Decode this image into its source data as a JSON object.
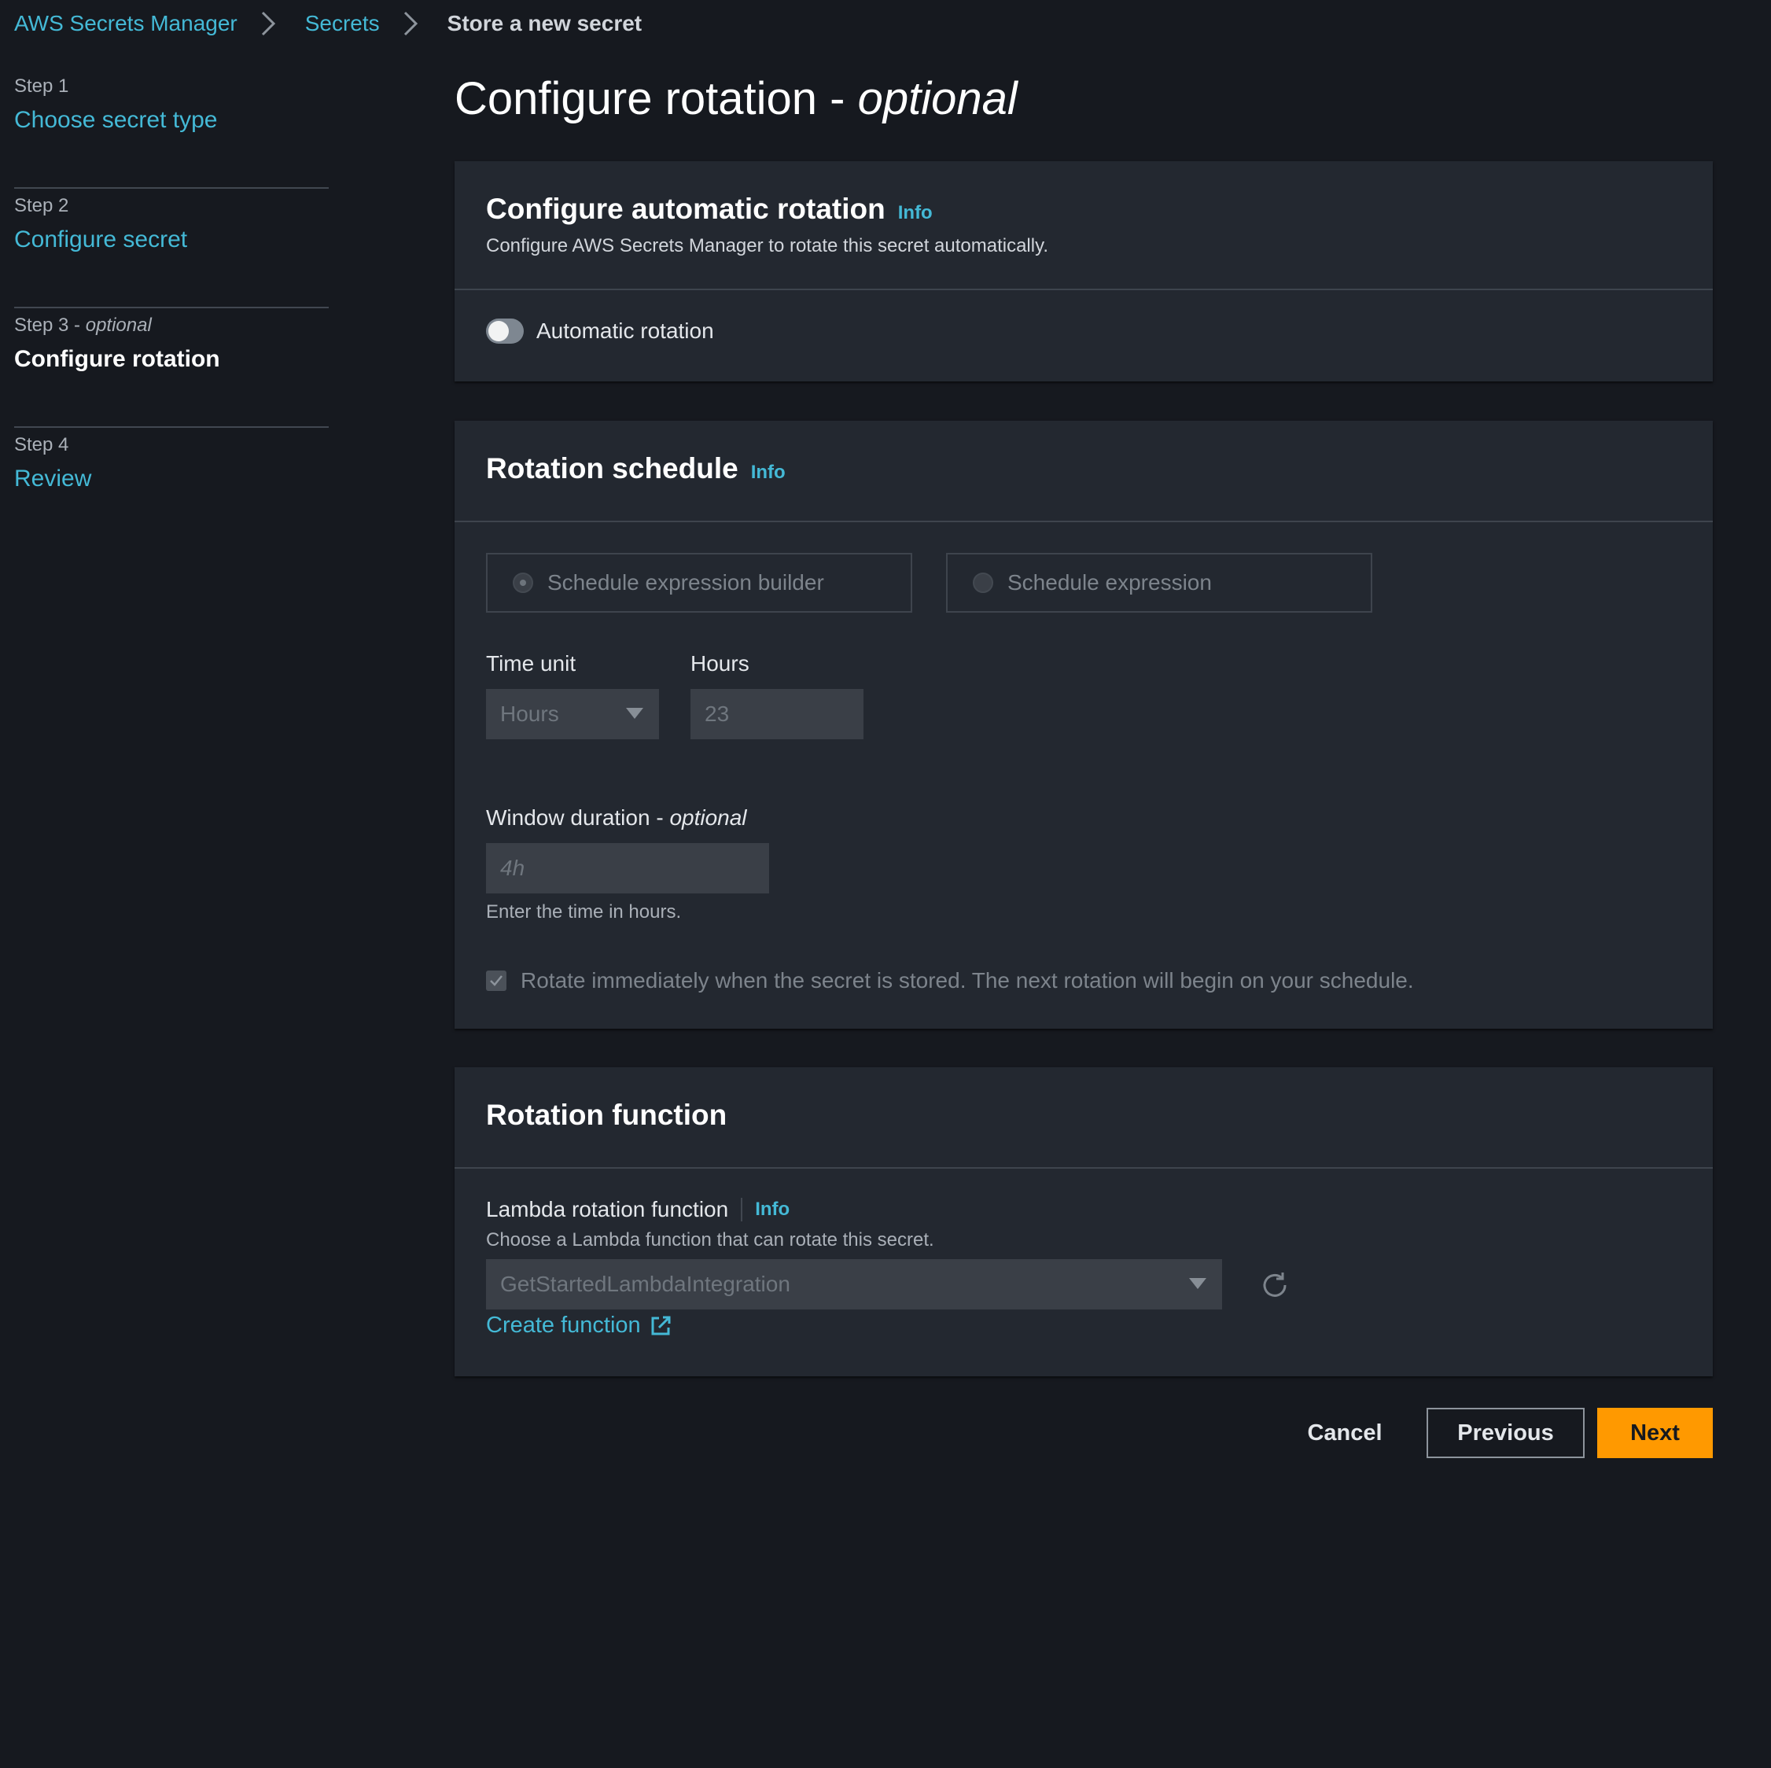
{
  "breadcrumb": {
    "items": [
      "AWS Secrets Manager",
      "Secrets"
    ],
    "current": "Store a new secret"
  },
  "steps": [
    {
      "num": "Step 1",
      "title": "Choose secret type"
    },
    {
      "num": "Step 2",
      "title": "Configure secret"
    },
    {
      "num": "Step 3",
      "optional": "optional",
      "title": "Configure rotation"
    },
    {
      "num": "Step 4",
      "title": "Review"
    }
  ],
  "step_sep": " - ",
  "page": {
    "title": "Configure rotation - ",
    "title_optional": "optional"
  },
  "auto_rotation": {
    "title": "Configure automatic rotation",
    "info": "Info",
    "description": "Configure AWS Secrets Manager to rotate this secret automatically.",
    "toggle_label": "Automatic rotation",
    "toggle_on": false
  },
  "schedule": {
    "title": "Rotation schedule",
    "info": "Info",
    "radio_builder": "Schedule expression builder",
    "radio_expression": "Schedule expression",
    "time_unit_label": "Time unit",
    "time_unit_value": "Hours",
    "hours_label": "Hours",
    "hours_value": "23",
    "window_label": "Window duration - ",
    "window_optional": "optional",
    "window_placeholder": "4h",
    "window_hint": "Enter the time in hours.",
    "rotate_immediately": "Rotate immediately when the secret is stored. The next rotation will begin on your schedule."
  },
  "function": {
    "title": "Rotation function",
    "lambda_label": "Lambda rotation function",
    "info": "Info",
    "lambda_desc": "Choose a Lambda function that can rotate this secret.",
    "lambda_value": "GetStartedLambdaIntegration",
    "create_link": "Create function"
  },
  "buttons": {
    "cancel": "Cancel",
    "previous": "Previous",
    "next": "Next"
  },
  "colors": {
    "accent_link": "#44b9d6",
    "primary_button": "#ff9900",
    "background": "#16191f",
    "card": "#232830"
  }
}
